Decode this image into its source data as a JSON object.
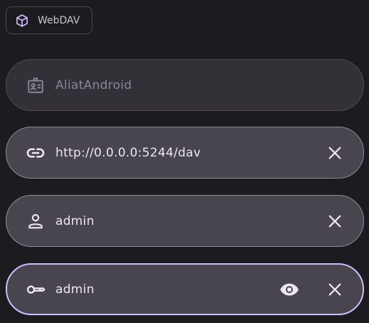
{
  "header": {
    "chip_label": "WebDAV",
    "chip_icon": "cube-icon",
    "accent": "#cfbcff"
  },
  "fields": {
    "name": {
      "value": "AliatAndroid",
      "icon": "id-badge-icon",
      "enabled": false
    },
    "url": {
      "value": "http://0.0.0.0:5244/dav",
      "icon": "link-icon",
      "trailing": "clear-icon"
    },
    "username": {
      "value": "admin",
      "icon": "person-icon",
      "trailing": "clear-icon"
    },
    "password": {
      "value": "admin",
      "icon": "key-icon",
      "trailing": [
        "visibility-icon",
        "clear-icon"
      ],
      "focused": true
    }
  }
}
